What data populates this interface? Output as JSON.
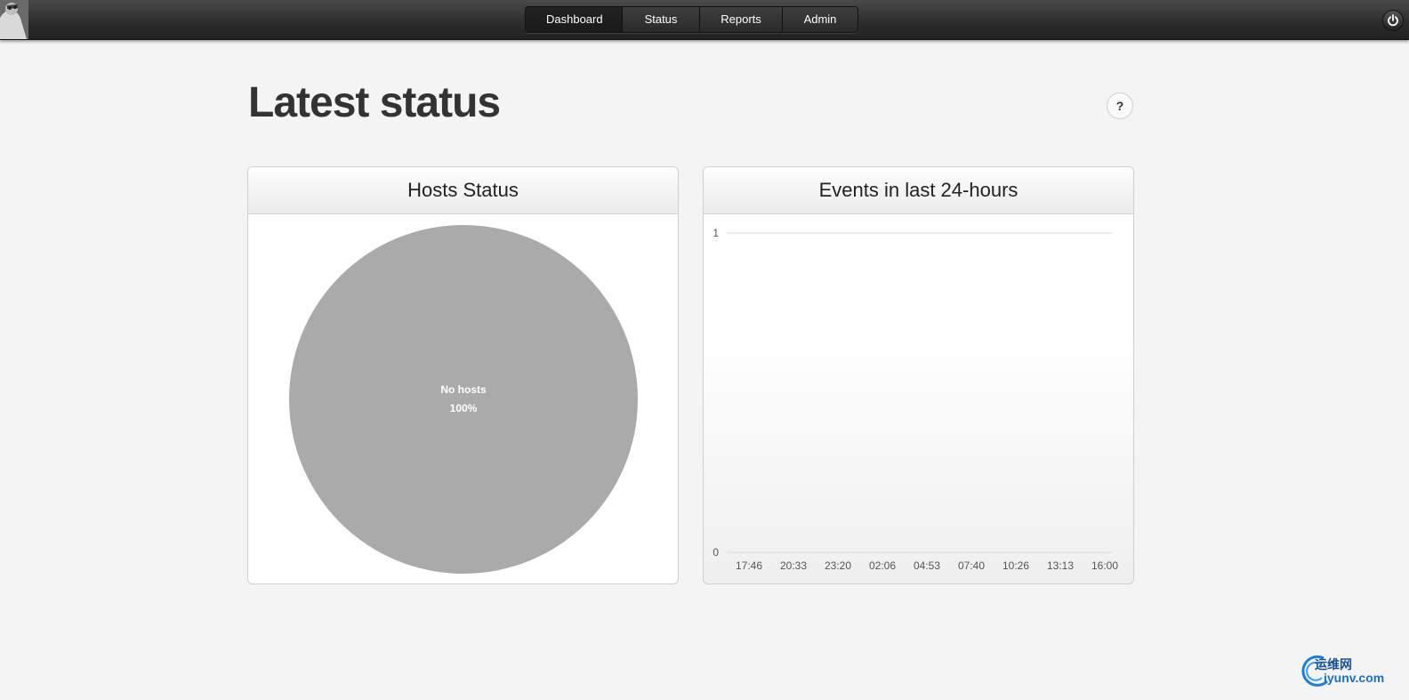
{
  "nav": {
    "items": [
      {
        "label": "Dashboard"
      },
      {
        "label": "Status"
      },
      {
        "label": "Reports"
      },
      {
        "label": "Admin"
      }
    ],
    "active": "Dashboard"
  },
  "page": {
    "title": "Latest status",
    "help_label": "?"
  },
  "hosts_panel": {
    "title": "Hosts Status",
    "chart_data": {
      "type": "pie",
      "slices": [
        {
          "label": "No hosts",
          "value": 100,
          "percent_label": "100%",
          "color": "#aaaaaa"
        }
      ]
    }
  },
  "events_panel": {
    "title": "Events in last 24-hours",
    "chart_data": {
      "type": "line",
      "x": [
        "17:46",
        "20:33",
        "23:20",
        "02:06",
        "04:53",
        "07:40",
        "10:26",
        "13:13",
        "16:00"
      ],
      "y_ticks": [
        "0",
        "1"
      ],
      "ylim": [
        0,
        1
      ],
      "series": []
    }
  },
  "watermark": {
    "cn": "运维网",
    "en": "iyunv.com"
  },
  "icons": {
    "power": "power-icon",
    "help": "help-icon",
    "avatar": "avatar-image"
  }
}
